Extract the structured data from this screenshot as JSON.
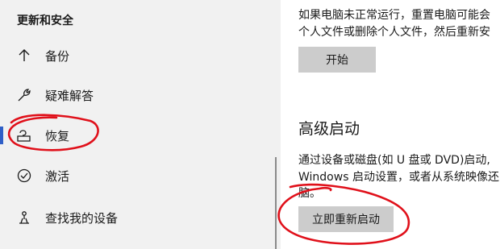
{
  "sidebar": {
    "title": "更新和安全",
    "items": [
      {
        "label": "备份",
        "icon": "arrow-up-icon"
      },
      {
        "label": "疑难解答",
        "icon": "wrench-icon"
      },
      {
        "label": "恢复",
        "icon": "recovery-icon",
        "selected": true
      },
      {
        "label": "激活",
        "icon": "check-circle-icon"
      },
      {
        "label": "查找我的设备",
        "icon": "find-device-icon"
      }
    ]
  },
  "reset": {
    "description_line1": "如果电脑未正常运行，重置电脑可能会",
    "description_line2": "个人文件或删除个人文件，然后重新安",
    "button_label": "开始"
  },
  "advanced_startup": {
    "heading": "高级启动",
    "description_line1": "通过设备或磁盘(如 U 盘或 DVD)启动,",
    "description_line2": "Windows 启动设置，或者从系统映像还",
    "description_line3": "脑。",
    "button_label": "立即重新启动"
  },
  "colors": {
    "sidebar_bg": "#f1f1f1",
    "accent": "#2f5fc7",
    "button_bg": "#cccccc",
    "annotation": "#e0101a"
  }
}
